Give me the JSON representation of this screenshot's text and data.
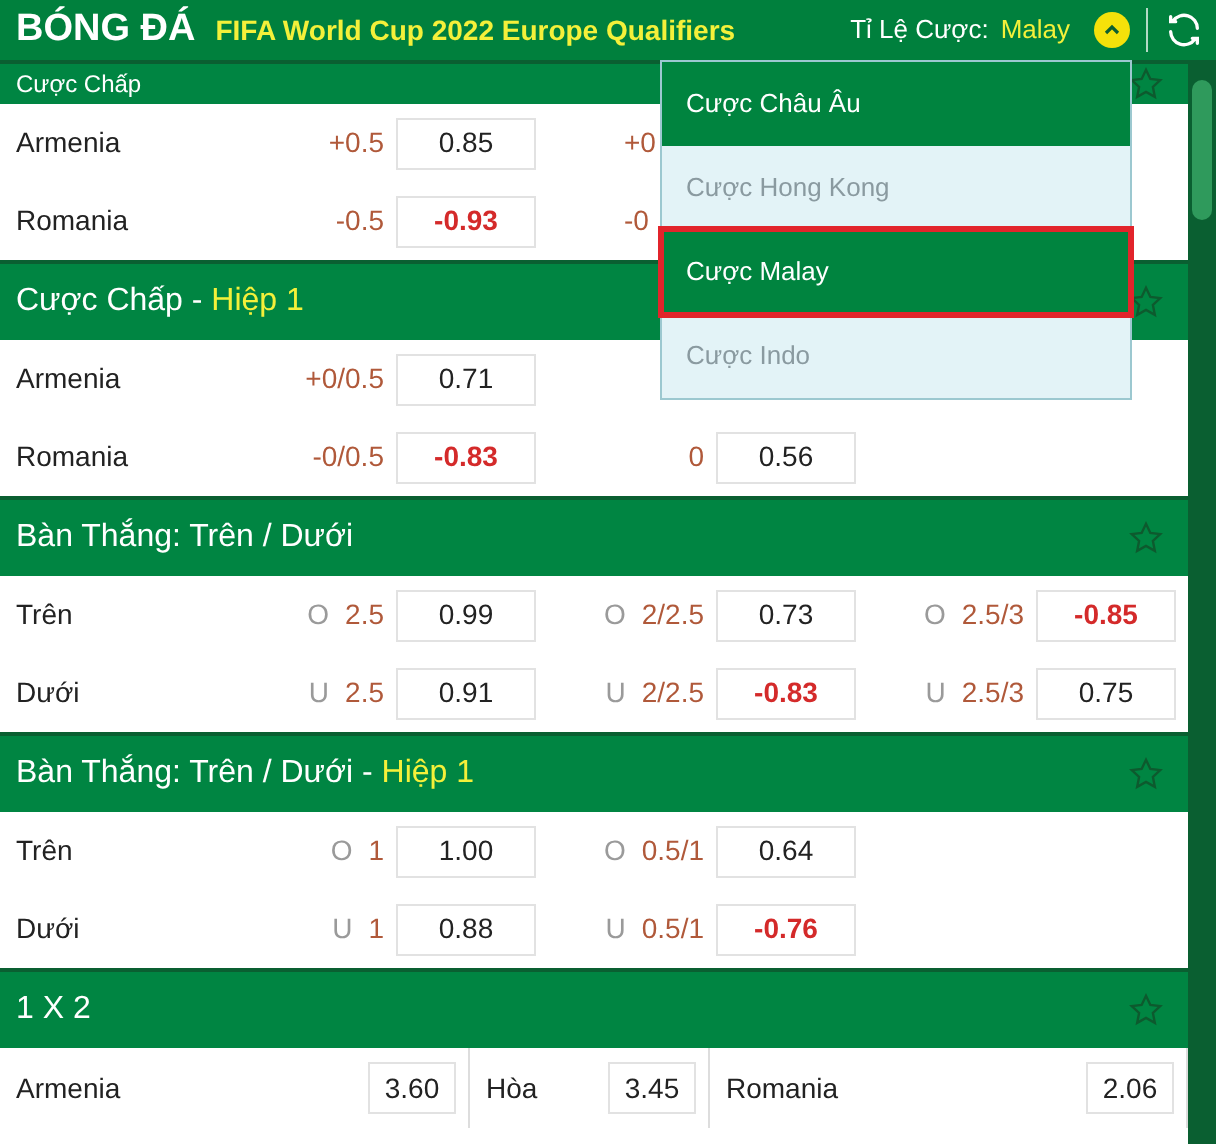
{
  "header": {
    "sport": "BÓNG ĐÁ",
    "competition": "FIFA World Cup 2022 Europe Qualifiers",
    "odds_label": "Tỉ Lệ Cược:",
    "odds_value": "Malay"
  },
  "odds_menu": [
    {
      "label": "Cược Châu Âu",
      "selected": false,
      "highlighted": true
    },
    {
      "label": "Cược Hong Kong",
      "selected": false,
      "highlighted": false
    },
    {
      "label": "Cược Malay",
      "selected": true,
      "highlighted": true
    },
    {
      "label": "Cược Indo",
      "selected": false,
      "highlighted": false
    }
  ],
  "sections": [
    {
      "kind": "lines",
      "title": "Cược Chấp",
      "rows": [
        {
          "label": "Armenia",
          "cells": [
            {
              "line": "+0.5",
              "odds": "0.85",
              "emphasized": false
            },
            {
              "line": "+0"
            },
            null
          ]
        },
        {
          "label": "Romania",
          "cells": [
            {
              "line": "-0.5",
              "odds": "-0.93",
              "emphasized": true
            },
            {
              "line": "-0"
            },
            null
          ]
        }
      ]
    },
    {
      "kind": "lines",
      "title": "Cược Chấp - ",
      "subtitle": "Hiệp 1",
      "rows": [
        {
          "label": "Armenia",
          "cells": [
            {
              "line": "+0/0.5",
              "odds": "0.71",
              "emphasized": false
            },
            null,
            null
          ]
        },
        {
          "label": "Romania",
          "cells": [
            {
              "line": "-0/0.5",
              "odds": "-0.83",
              "emphasized": true
            },
            {
              "line": "0",
              "odds": "0.56",
              "emphasized": false
            },
            null
          ]
        }
      ]
    },
    {
      "kind": "lines",
      "title": "Bàn Thắng: Trên / Dưới",
      "rows": [
        {
          "label": "Trên",
          "cells": [
            {
              "prefix": "O",
              "line": "2.5",
              "odds": "0.99",
              "emphasized": false
            },
            {
              "prefix": "O",
              "line": "2/2.5",
              "odds": "0.73",
              "emphasized": false
            },
            {
              "prefix": "O",
              "line": "2.5/3",
              "odds": "-0.85",
              "emphasized": true
            }
          ]
        },
        {
          "label": "Dưới",
          "cells": [
            {
              "prefix": "U",
              "line": "2.5",
              "odds": "0.91",
              "emphasized": false
            },
            {
              "prefix": "U",
              "line": "2/2.5",
              "odds": "-0.83",
              "emphasized": true
            },
            {
              "prefix": "U",
              "line": "2.5/3",
              "odds": "0.75",
              "emphasized": false
            }
          ]
        }
      ]
    },
    {
      "kind": "lines",
      "title": "Bàn Thắng: Trên / Dưới - ",
      "subtitle": "Hiệp 1",
      "rows": [
        {
          "label": "Trên",
          "cells": [
            {
              "prefix": "O",
              "line": "1",
              "odds": "1.00",
              "emphasized": false
            },
            {
              "prefix": "O",
              "line": "0.5/1",
              "odds": "0.64",
              "emphasized": false
            },
            null
          ]
        },
        {
          "label": "Dưới",
          "cells": [
            {
              "prefix": "U",
              "line": "1",
              "odds": "0.88",
              "emphasized": false
            },
            {
              "prefix": "U",
              "line": "0.5/1",
              "odds": "-0.76",
              "emphasized": true
            },
            null
          ]
        }
      ]
    },
    {
      "kind": "outcomes",
      "title": "1 X 2",
      "cells": [
        {
          "label": "Armenia",
          "odds": "3.60"
        },
        {
          "label": "Hòa",
          "odds": "3.45"
        },
        {
          "label": "Romania",
          "odds": "2.06"
        }
      ]
    }
  ]
}
